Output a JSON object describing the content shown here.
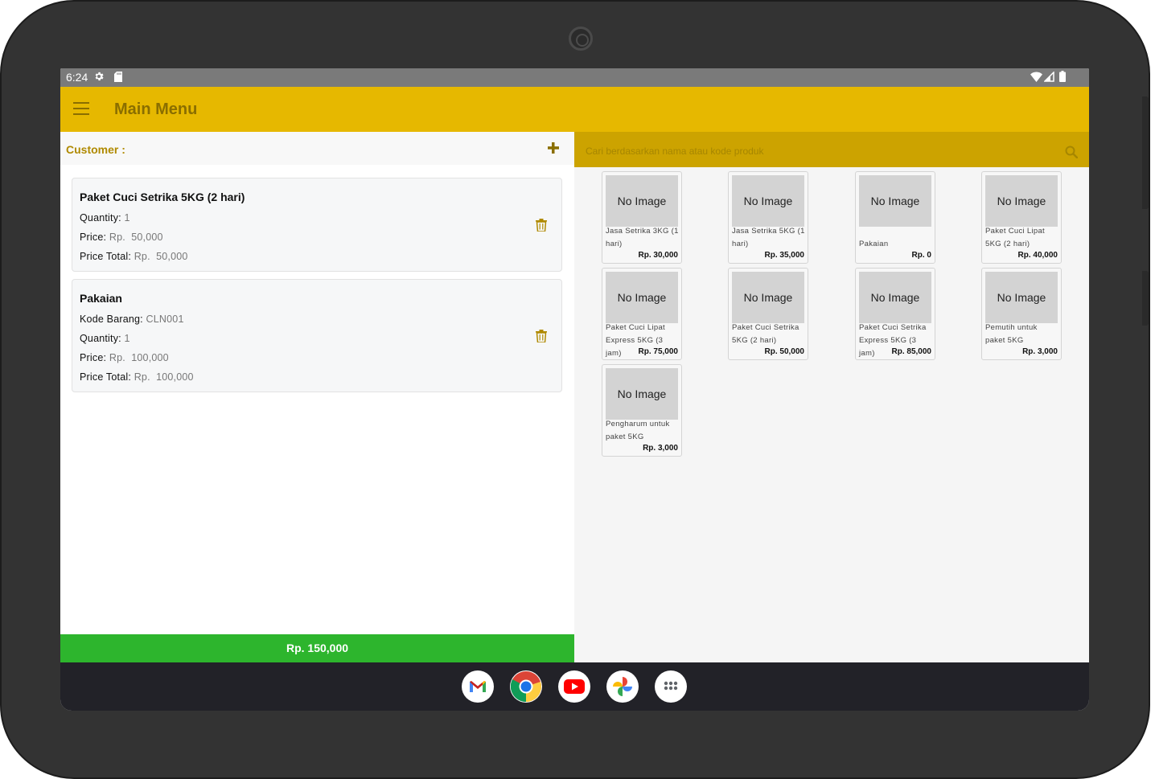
{
  "status_bar": {
    "time": "6:24"
  },
  "app_bar": {
    "title": "Main Menu"
  },
  "customer": {
    "label": "Customer :"
  },
  "cart": {
    "items": [
      {
        "name": "Paket Cuci Setrika 5KG (2 hari)",
        "quantity_label": "Quantity:",
        "quantity": "1",
        "price_label": "Price:",
        "price": "Rp.  50,000",
        "total_label": "Price Total:",
        "total": "Rp.  50,000"
      },
      {
        "name": "Pakaian",
        "code_label": "Kode Barang:",
        "code": "CLN001",
        "quantity_label": "Quantity:",
        "quantity": "1",
        "price_label": "Price:",
        "price": "Rp.  100,000",
        "total_label": "Price Total:",
        "total": "Rp.  100,000"
      }
    ],
    "grand_total": "Rp. 150,000"
  },
  "search": {
    "placeholder": "Cari berdasarkan nama atau kode produk"
  },
  "products": [
    {
      "image_text": "No Image",
      "name": "Jasa Setrika 3KG (1 hari)",
      "price": "Rp. 30,000"
    },
    {
      "image_text": "No Image",
      "name": "Jasa Setrika 5KG (1 hari)",
      "price": "Rp. 35,000"
    },
    {
      "image_text": "No Image",
      "name": "Pakaian",
      "price": "Rp. 0"
    },
    {
      "image_text": "No Image",
      "name": "Paket Cuci Lipat 5KG (2 hari)",
      "price": "Rp. 40,000"
    },
    {
      "image_text": "No Image",
      "name": "Paket Cuci Lipat Express 5KG (3 jam)",
      "price": "Rp. 75,000"
    },
    {
      "image_text": "No Image",
      "name": "Paket Cuci Setrika 5KG (2 hari)",
      "price": "Rp. 50,000"
    },
    {
      "image_text": "No Image",
      "name": "Paket Cuci Setrika Express 5KG (3 jam)",
      "price": "Rp. 85,000"
    },
    {
      "image_text": "No Image",
      "name": "Pemutih untuk paket 5KG",
      "price": "Rp. 3,000"
    },
    {
      "image_text": "No Image",
      "name": "Pengharum untuk paket 5KG",
      "price": "Rp. 3,000"
    }
  ],
  "dock": {
    "apps": [
      "gmail-icon",
      "chrome-icon",
      "youtube-icon",
      "photos-icon",
      "app-drawer-icon"
    ]
  },
  "colors": {
    "app_bar": "#e6b800",
    "search_bar": "#cca300",
    "accent_text": "#8a6e00",
    "total_bar": "#2db52d"
  }
}
